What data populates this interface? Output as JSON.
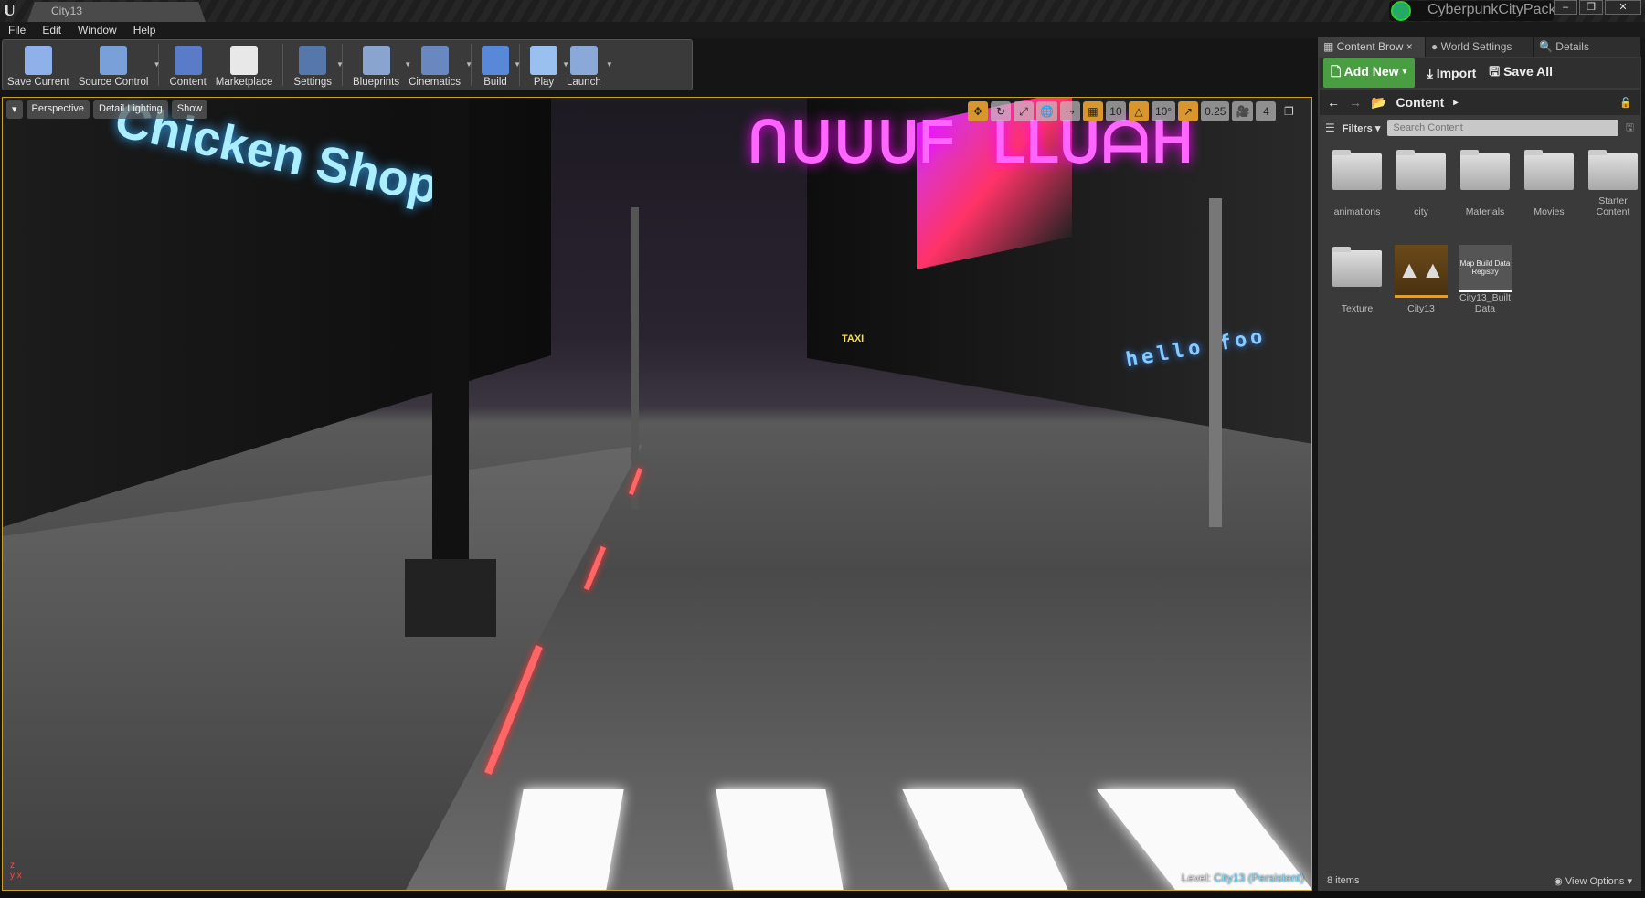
{
  "window": {
    "doc_tab": "City13",
    "project": "CyberpunkCityPack",
    "controls": [
      "–",
      "❐",
      "✕"
    ]
  },
  "menu": [
    "File",
    "Edit",
    "Window",
    "Help"
  ],
  "toolbar": [
    {
      "label": "Save Current",
      "icon": "save-icon",
      "dropdown": false,
      "color": "#8fb0e8"
    },
    {
      "label": "Source Control",
      "icon": "source-control-icon",
      "dropdown": true,
      "color": "#7aa0d8"
    },
    {
      "label": "Content",
      "icon": "content-icon",
      "dropdown": false,
      "color": "#5a7cc8"
    },
    {
      "label": "Marketplace",
      "icon": "marketplace-icon",
      "dropdown": false,
      "color": "#e8e8e8"
    },
    {
      "label": "Settings",
      "icon": "gear-icon",
      "dropdown": true,
      "color": "#5577aa"
    },
    {
      "label": "Blueprints",
      "icon": "blueprints-icon",
      "dropdown": true,
      "color": "#8aa4d0"
    },
    {
      "label": "Cinematics",
      "icon": "clapper-icon",
      "dropdown": true,
      "color": "#6a88c0"
    },
    {
      "label": "Build",
      "icon": "build-icon",
      "dropdown": true,
      "color": "#5a88d8"
    },
    {
      "label": "Play",
      "icon": "play-icon",
      "dropdown": true,
      "color": "#9ac0f0"
    },
    {
      "label": "Launch",
      "icon": "launch-icon",
      "dropdown": true,
      "color": "#8aa8d8"
    }
  ],
  "viewport": {
    "buttons": [
      "▾",
      "Perspective",
      "Detail Lighting",
      "Show"
    ],
    "controls": {
      "translate": "✥",
      "rotate": "↻",
      "scale": "⤢",
      "world": "🌐",
      "surface_snap": "⤳",
      "grid_snap": "▦",
      "grid_value": "10",
      "rotate_snap": "△",
      "rotate_value": "10°",
      "scale_snap": "↗",
      "scale_value": "0.25",
      "camera_speed_icon": "🎥",
      "camera_speed": "4",
      "maximize": "❐"
    },
    "level_label": "Level:",
    "level_name": "City13 (Persistent)",
    "scene_signs": {
      "shop": "Chicken Shop",
      "neon": "ᑎᑌᑌᑌᖴ ᒪᒪᑌᗩᕼ",
      "hello": "hello foo",
      "taxi": "TAXI"
    },
    "accent": "#c9a227"
  },
  "content_browser": {
    "tabs": [
      "Content Brow",
      "World Settings",
      "Details"
    ],
    "add_new": "Add New ▾",
    "import": "Import",
    "save_all": "Save All",
    "path": "Content",
    "filters": "Filters ▾",
    "search_placeholder": "Search Content",
    "items": [
      {
        "label": "animations",
        "type": "folder"
      },
      {
        "label": "city",
        "type": "folder"
      },
      {
        "label": "Materials",
        "type": "folder"
      },
      {
        "label": "Movies",
        "type": "folder"
      },
      {
        "label": "Starter Content",
        "type": "folder"
      },
      {
        "label": "Texture",
        "type": "folder"
      },
      {
        "label": "City13",
        "type": "level"
      },
      {
        "label": "City13_Built Data",
        "type": "registry",
        "thumb_text": "Map Build Data Registry"
      }
    ],
    "count": "8 items",
    "view_options": "View Options ▾"
  }
}
